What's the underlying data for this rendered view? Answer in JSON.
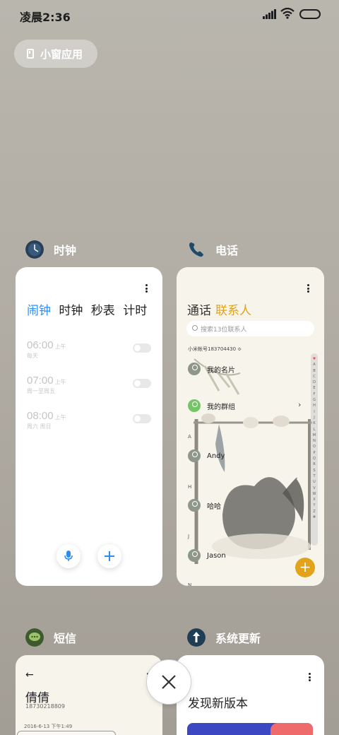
{
  "status_bar": {
    "time": "凌晨2:36"
  },
  "small_window": {
    "label": "小窗应用"
  },
  "apps": [
    {
      "name": "时钟"
    },
    {
      "name": "电话"
    },
    {
      "name": "短信"
    },
    {
      "name": "系统更新"
    }
  ],
  "clock": {
    "tabs": [
      "闹钟",
      "时钟",
      "秒表",
      "计时"
    ],
    "alarms": [
      {
        "time": "06:00",
        "ampm": "上午",
        "repeat": "每天"
      },
      {
        "time": "07:00",
        "ampm": "上午",
        "repeat": "周一至周五"
      },
      {
        "time": "08:00",
        "ampm": "上午",
        "repeat": "周六 周日"
      }
    ]
  },
  "phone": {
    "tab_calls": "通话",
    "tab_contacts": "联系人",
    "search_placeholder": "搜索13位联系人",
    "account": "小米帐号183704430 ≎",
    "sections": [
      "A",
      "H",
      "J",
      "N"
    ],
    "contacts": [
      "我的名片",
      "我的群组",
      "Andy",
      "哈哈",
      "Jason"
    ],
    "alphabet": [
      "♥",
      "A",
      "B",
      "C",
      "D",
      "E",
      "F",
      "G",
      "H",
      "I",
      "J",
      "K",
      "L",
      "M",
      "N",
      "O",
      "P",
      "Q",
      "R",
      "S",
      "T",
      "U",
      "V",
      "W",
      "X",
      "Y",
      "Z",
      "#"
    ],
    "fab": "+"
  },
  "sms": {
    "contact_name": "倩倩",
    "number": "18730218809",
    "date": "2016-6-13 下午1:49"
  },
  "update": {
    "title": "发现新版本"
  },
  "colors": {
    "accent_blue": "#2c8cf0",
    "accent_gold": "#e2a21a",
    "update_blue": "#3c47c4",
    "update_red": "#ef6b6b"
  }
}
